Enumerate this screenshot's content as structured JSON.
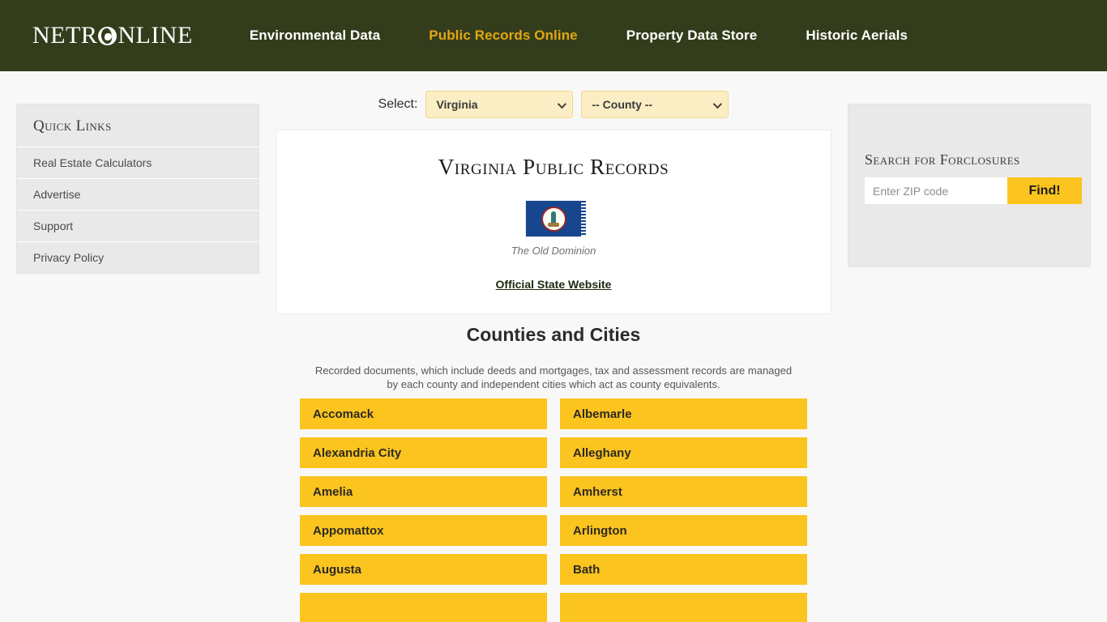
{
  "header": {
    "brand": {
      "before": "NETR",
      "globe_icon": "globe-icon",
      "after": "NLINE"
    },
    "nav": [
      {
        "label": "Environmental Data",
        "active": false
      },
      {
        "label": "Public Records Online",
        "active": true
      },
      {
        "label": "Property Data Store",
        "active": false
      },
      {
        "label": "Historic Aerials",
        "active": false
      }
    ],
    "background_color": "#343D1B",
    "active_color": "#E2A713"
  },
  "left_sidebar": {
    "title": "Quick Links",
    "items": [
      {
        "label": "Real Estate Calculators"
      },
      {
        "label": "Advertise"
      },
      {
        "label": "Support"
      },
      {
        "label": "Privacy Policy"
      }
    ]
  },
  "select_bar": {
    "label": "Select:",
    "state_select": {
      "value": "Virginia",
      "options": [
        "Virginia"
      ]
    },
    "county_select": {
      "value": "-- County --",
      "options": [
        "-- County --"
      ]
    }
  },
  "state_card": {
    "title": "Virginia Public Records",
    "flag_icon": "virginia-state-flag-icon",
    "nickname": "The Old Dominion",
    "official_link": "Official State Website"
  },
  "counties": {
    "title": "Counties and Cities",
    "description": "Recorded documents, which include deeds and mortgages, tax and assessment records are managed by each county and independent cities which act as county equivalents.",
    "button_color": "#FBC41F",
    "items": [
      "Accomack",
      "Albemarle",
      "Alexandria City",
      "Alleghany",
      "Amelia",
      "Amherst",
      "Appomattox",
      "Arlington",
      "Augusta",
      "Bath",
      "",
      ""
    ]
  },
  "right_sidebar": {
    "title": "Search for Forclosures",
    "zip_placeholder": "Enter ZIP code",
    "zip_value": "",
    "find_label": "Find!"
  }
}
